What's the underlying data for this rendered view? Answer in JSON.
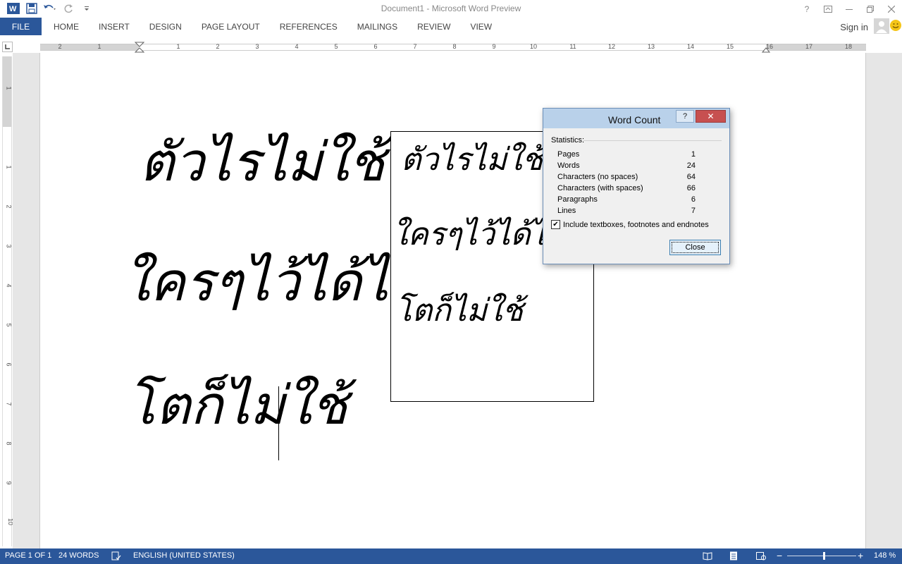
{
  "window": {
    "title": "Document1 - Microsoft Word Preview"
  },
  "ribbon": {
    "file_tab": "FILE",
    "tabs": [
      "HOME",
      "INSERT",
      "DESIGN",
      "PAGE LAYOUT",
      "REFERENCES",
      "MAILINGS",
      "REVIEW",
      "VIEW"
    ],
    "sign_in": "Sign in"
  },
  "ruler": {
    "h_numbers": [
      "2",
      "1",
      "1",
      "2",
      "3",
      "4",
      "5",
      "6",
      "7",
      "8",
      "9",
      "10",
      "11",
      "12",
      "13",
      "14",
      "15",
      "16",
      "17",
      "18"
    ],
    "v_numbers": [
      "1",
      "1",
      "2",
      "3",
      "4",
      "5",
      "6",
      "7",
      "8",
      "9",
      "10"
    ]
  },
  "document": {
    "lines": [
      "ตัวไรไม่ใช้",
      "ใครๆไว้ได้ไง",
      "โตก็ไม่ใช้"
    ],
    "textbox_lines": [
      "ตัวไรไม่ใช้",
      "ใครๆไว้ได้ไง",
      "โตก็ไม่ใช้"
    ]
  },
  "dialog": {
    "title": "Word Count",
    "help_label": "?",
    "close_x": "✕",
    "statistics_label": "Statistics:",
    "stats": [
      {
        "label": "Pages",
        "value": "1"
      },
      {
        "label": "Words",
        "value": "24"
      },
      {
        "label": "Characters (no spaces)",
        "value": "64"
      },
      {
        "label": "Characters (with spaces)",
        "value": "66"
      },
      {
        "label": "Paragraphs",
        "value": "6"
      },
      {
        "label": "Lines",
        "value": "7"
      }
    ],
    "checkbox_label": "Include textboxes, footnotes and endnotes",
    "checkbox_checked": true,
    "close_button": "Close"
  },
  "statusbar": {
    "page": "PAGE 1 OF 1",
    "words": "24 WORDS",
    "language": "ENGLISH (UNITED STATES)",
    "zoom": "148 %"
  },
  "colors": {
    "accent": "#2b579a",
    "dialog_title": "#b9d1ea",
    "close_red": "#c75050"
  }
}
